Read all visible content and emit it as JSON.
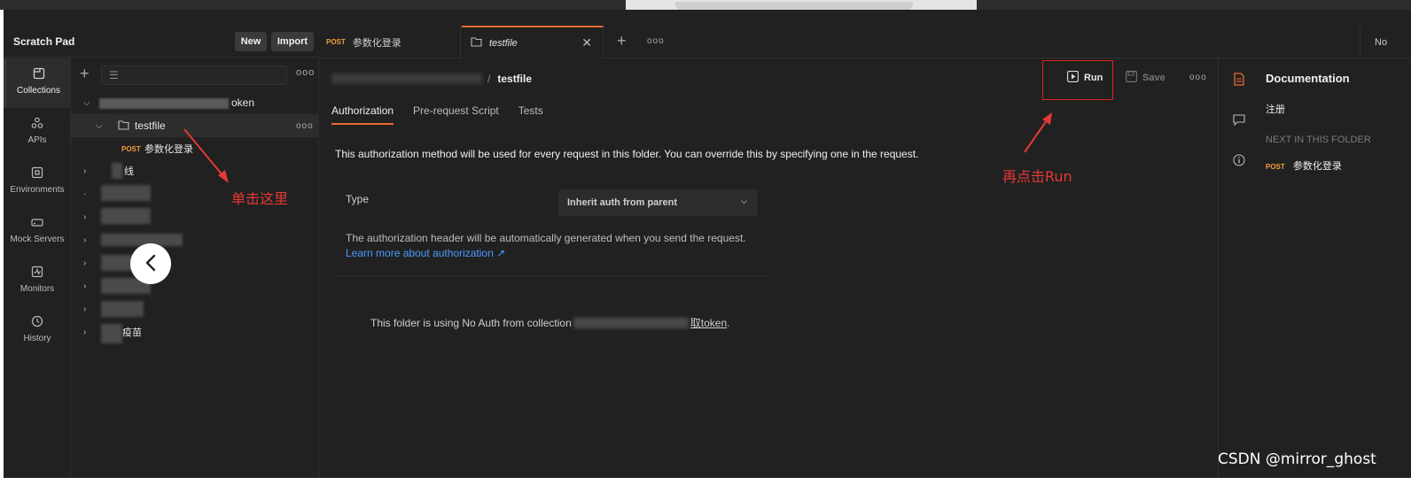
{
  "sidebar": {
    "title": "Scratch Pad",
    "new_label": "New",
    "import_label": "Import",
    "rail": [
      {
        "label": "Collections",
        "icon": "collections-icon"
      },
      {
        "label": "APIs",
        "icon": "apis-icon"
      },
      {
        "label": "Environments",
        "icon": "environments-icon"
      },
      {
        "label": "Mock Servers",
        "icon": "mock-servers-icon"
      },
      {
        "label": "Monitors",
        "icon": "monitors-icon"
      },
      {
        "label": "History",
        "icon": "history-icon"
      }
    ]
  },
  "tree": {
    "collection_suffix": "oken",
    "folder_name": "testfile",
    "request_method": "POST",
    "request_name": "参数化登录",
    "item_partial_1": "线",
    "item_partial_2": "疫苗"
  },
  "tabs": {
    "tab1_method": "POST",
    "tab1_name": "参数化登录",
    "tab2_name": "testfile",
    "env_label": "No"
  },
  "main": {
    "crumb_sep": "/",
    "crumb_name": "testfile",
    "run_label": "Run",
    "save_label": "Save",
    "subtabs": [
      "Authorization",
      "Pre-request Script",
      "Tests"
    ],
    "auth_description": "This authorization method will be used for every request in this folder. You can override this by specifying one in the request.",
    "type_label": "Type",
    "type_value": "Inherit auth from parent",
    "auth_note": "The authorization header will be automatically generated when you send the request.",
    "auth_link": "Learn more about authorization ↗",
    "noauth_prefix": "This folder is using No Auth from collection",
    "noauth_link": "取token",
    "noauth_end": "."
  },
  "docs": {
    "title": "Documentation",
    "description": "注册",
    "next_label": "NEXT IN THIS FOLDER",
    "next_method": "POST",
    "next_name": "参数化登录"
  },
  "annotations": {
    "click_here": "单击这里",
    "click_run": "再点击Run",
    "color": "#e53935"
  },
  "watermark": "CSDN @mirror_ghost",
  "colors": {
    "accent": "#e86a33",
    "post_method": "#f09d3e",
    "link": "#4a9bff",
    "background": "#212121"
  }
}
